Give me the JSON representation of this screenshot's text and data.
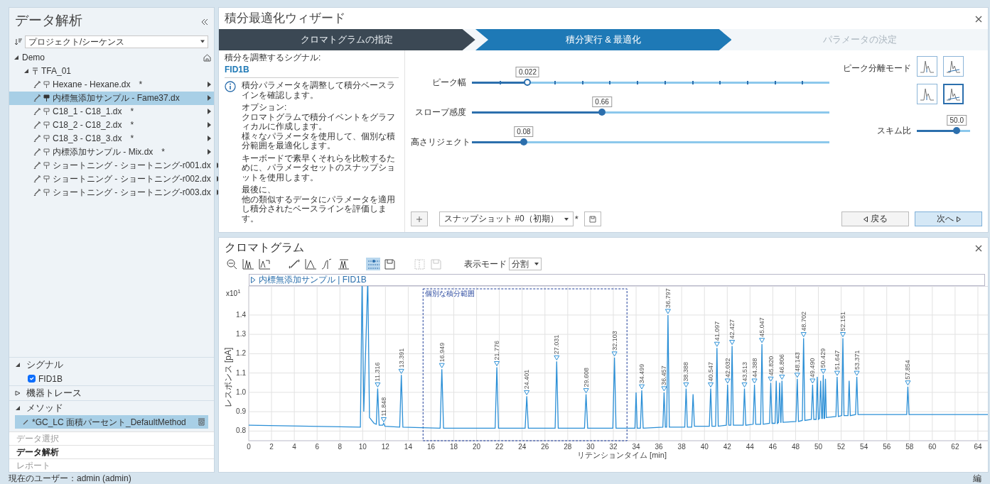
{
  "left_panel": {
    "title": "データ解析",
    "selector": {
      "value": "プロジェクト/シーケンス"
    },
    "tree": [
      {
        "label": "Demo",
        "expanded": true,
        "children": [
          {
            "label": "TFA_01",
            "expanded": true,
            "children": [
              {
                "label": "Hexane - Hexane.dx",
                "flag": "*",
                "selected": false
              },
              {
                "label": "内標無添加サンプル - Fame37.dx",
                "selected": true
              },
              {
                "label": "C18_1 - C18_1.dx",
                "flag": "*",
                "selected": false
              },
              {
                "label": "C18_2 - C18_2.dx",
                "flag": "*",
                "selected": false
              },
              {
                "label": "C18_3 - C18_3.dx",
                "flag": "*",
                "selected": false
              },
              {
                "label": "内標添加サンプル - Mix.dx",
                "flag": "*",
                "selected": false
              },
              {
                "label": "ショートニング - ショートニング-r001.dx",
                "selected": false
              },
              {
                "label": "ショートニング - ショートニング-r002.dx",
                "selected": false
              },
              {
                "label": "ショートニング - ショートニング-r003.dx",
                "selected": false
              }
            ]
          }
        ]
      }
    ],
    "sections": [
      {
        "label": "シグナル",
        "expanded": true,
        "items": [
          {
            "kind": "checkbox",
            "label": "FID1B",
            "checked": true
          }
        ]
      },
      {
        "label": "機器トレース",
        "expanded": false
      },
      {
        "label": "メソッド",
        "expanded": true,
        "items": [
          {
            "kind": "method",
            "label": "*GC_LC 面積パーセント_DefaultMethod",
            "selected": true
          }
        ]
      }
    ],
    "nav": [
      {
        "label": "データ選択",
        "selected": false
      },
      {
        "label": "データ解析",
        "selected": true
      },
      {
        "label": "レポート",
        "selected": false
      }
    ]
  },
  "wizard": {
    "title": "積分最適化ウィザード",
    "steps": [
      {
        "label": "クロマトグラムの指定",
        "done": true,
        "selected": false
      },
      {
        "label": "積分実行 & 最適化",
        "done": false,
        "selected": true
      },
      {
        "label": "パラメータの決定",
        "done": false,
        "selected": false
      }
    ],
    "signal_label": "積分を調整するシグナル:",
    "signal": "FID1B",
    "info": [
      [
        "積分パラメータを調整して積分ベースラインを確認します。"
      ],
      [
        "オプション:",
        "クロマトグラムで積分イベントをグラフィカルに作成します。",
        "様々なパラメータを使用して、個別な積分範囲を最適化します。"
      ],
      [
        "キーボードで素早くそれらを比較するために、パラメータセットのスナップショットを使用します。"
      ],
      [
        "最後に、",
        "他の類似するデータにパラメータを適用し積分されたベースラインを評価します。"
      ]
    ],
    "sliders": [
      {
        "label": "ピーク幅",
        "kind": "ticked",
        "level": 0.156,
        "reading": "0.022"
      },
      {
        "label": "スロープ感度",
        "kind": "plain",
        "level": 0.364,
        "reading": "0.66"
      },
      {
        "label": "高さリジェクト",
        "kind": "plain",
        "level": 0.145,
        "reading": "0.08"
      }
    ],
    "peak_mode": {
      "label": "ピーク分離モード",
      "options": [
        {
          "selected": false
        },
        {
          "selected": false
        },
        {
          "selected": false
        },
        {
          "selected": true
        }
      ]
    },
    "skim": {
      "label": "スキム比",
      "level": 0.75,
      "reading": "50.0"
    },
    "snapshot": {
      "value": "スナップショット #0（初期）",
      "flag": "*"
    },
    "buttons": [
      {
        "label": "戻る",
        "kind": "back"
      },
      {
        "label": "次へ",
        "kind": "next"
      }
    ]
  },
  "chromatogram": {
    "title": "クロマトグラム",
    "toolbar": [
      {
        "selected": false,
        "disabled": false
      },
      {
        "selected": false,
        "disabled": false
      },
      {
        "selected": false,
        "disabled": false
      },
      {
        "selected": false,
        "disabled": false
      },
      {
        "selected": false,
        "disabled": false
      },
      {
        "selected": false,
        "disabled": false
      },
      {
        "selected": false,
        "disabled": false
      },
      {
        "selected": true,
        "disabled": false
      },
      {
        "selected": false,
        "disabled": false
      },
      {
        "selected": false,
        "disabled": true
      },
      {
        "selected": false,
        "disabled": true
      }
    ],
    "display_mode": {
      "label": "表示モード",
      "value": "分割"
    },
    "scale_label": "x10$^{1}$",
    "chart_data": {
      "type": "line",
      "title": "内標無添加サンプル | FID1B",
      "xlabel": "リテンションタイム [min]",
      "ylabel": "レスポンス [pA]",
      "grid": true,
      "xlim": [
        0,
        65.5
      ],
      "ylim": [
        0.75,
        1.55
      ],
      "xticks": [
        0,
        2,
        4,
        6,
        8,
        10,
        12,
        14,
        16,
        18,
        20,
        22,
        24,
        26,
        28,
        30,
        32,
        34,
        36,
        38,
        40,
        42,
        44,
        46,
        48,
        50,
        52,
        54,
        56,
        58,
        60,
        62,
        64
      ],
      "yticks": [
        0.8,
        0.9,
        {
          "value": 1,
          "label": "1.0"
        },
        1.1,
        1.2,
        1.3,
        1.4
      ],
      "x": [
        0,
        9.8,
        9.95,
        10.1,
        10.45,
        10.6,
        11.0,
        11.2,
        11.316,
        11.45,
        11.75,
        11.848,
        11.95,
        13.25,
        13.391,
        13.53,
        16.8,
        16.949,
        17.1,
        21.63,
        21.776,
        21.92,
        24.26,
        24.401,
        24.54,
        26.89,
        27.031,
        27.17,
        29.47,
        29.608,
        29.75,
        31.96,
        32.103,
        32.24,
        33.9,
        34.0,
        34.1,
        34.38,
        34.499,
        34.62,
        36.35,
        36.457,
        36.57,
        36.68,
        36.797,
        36.92,
        38.27,
        38.388,
        38.5,
        38.88,
        39.0,
        39.12,
        40.43,
        40.547,
        40.66,
        40.98,
        41.097,
        41.21,
        41.92,
        42.032,
        42.14,
        42.31,
        42.427,
        42.54,
        43.4,
        43.513,
        43.63,
        44.27,
        44.388,
        44.5,
        44.93,
        45.047,
        45.16,
        45.71,
        45.82,
        45.93,
        46.2,
        46.3,
        46.4,
        46.5,
        46.6,
        46.7,
        46.72,
        46.806,
        46.9,
        48.03,
        48.143,
        48.25,
        48.59,
        48.702,
        48.81,
        49.38,
        49.49,
        49.6,
        49.8,
        49.9,
        50.0,
        50.1,
        50.2,
        50.3,
        50.35,
        50.429,
        50.5,
        50.55,
        50.62,
        50.7,
        51.54,
        51.647,
        51.75,
        52.05,
        52.151,
        52.25,
        52.6,
        52.7,
        52.8,
        53.26,
        53.371,
        53.48,
        57.75,
        57.854,
        57.96,
        65.5
      ],
      "series": [
        {
          "color": "#2b8fd6",
          "values": [
            0.83,
            0.82,
            null,
            0.9,
            null,
            0.87,
            0.84,
            0.835,
            1.02,
            0.83,
            0.83,
            0.84,
            0.825,
            0.82,
            1.09,
            0.82,
            0.815,
            1.12,
            0.815,
            0.815,
            1.13,
            0.815,
            0.815,
            0.98,
            0.815,
            0.815,
            1.16,
            0.815,
            0.815,
            0.99,
            0.815,
            0.815,
            1.18,
            0.815,
            0.815,
            1.0,
            0.815,
            0.815,
            1.01,
            0.815,
            0.82,
            1.0,
            0.82,
            0.82,
            1.4,
            0.82,
            0.82,
            1.02,
            0.82,
            0.82,
            0.99,
            0.825,
            0.825,
            1.02,
            0.825,
            0.825,
            1.23,
            0.825,
            0.83,
            1.04,
            0.83,
            0.83,
            1.24,
            0.83,
            0.83,
            1.02,
            0.83,
            0.835,
            1.04,
            0.835,
            0.835,
            1.25,
            0.835,
            0.84,
            1.05,
            0.84,
            0.84,
            1.06,
            0.84,
            0.845,
            1.05,
            0.845,
            0.845,
            1.06,
            0.845,
            0.85,
            1.07,
            0.85,
            0.855,
            1.28,
            0.855,
            0.86,
            1.04,
            0.86,
            0.86,
            1.08,
            0.86,
            0.865,
            1.06,
            0.865,
            0.865,
            1.09,
            0.865,
            0.865,
            1.07,
            0.87,
            0.875,
            1.08,
            0.875,
            0.88,
            1.28,
            0.88,
            0.88,
            1.06,
            0.88,
            0.885,
            1.08,
            0.885,
            0.885,
            1.03,
            0.885,
            0.885
          ]
        }
      ],
      "annotations": [
        "個別な積分範囲",
        {
          "x": 11.316,
          "y": 1.02,
          "text": "11.316"
        },
        {
          "x": 11.848,
          "y": 0.84,
          "text": "11.848"
        },
        {
          "x": 13.391,
          "y": 1.09,
          "text": "13.391"
        },
        {
          "x": 16.949,
          "y": 1.12,
          "text": "16.949"
        },
        {
          "x": 21.776,
          "y": 1.13,
          "text": "21.776"
        },
        {
          "x": 24.401,
          "y": 0.98,
          "text": "24.401"
        },
        {
          "x": 27.031,
          "y": 1.16,
          "text": "27.031"
        },
        {
          "x": 29.608,
          "y": 0.99,
          "text": "29.608"
        },
        {
          "x": 32.103,
          "y": 1.18,
          "text": "32.103"
        },
        {
          "x": 34.499,
          "y": 1.01,
          "text": "34.499"
        },
        {
          "x": 36.457,
          "y": 1.0,
          "text": "36.457"
        },
        {
          "x": 36.797,
          "y": 1.4,
          "text": "36.797"
        },
        {
          "x": 38.388,
          "y": 1.02,
          "text": "38.388"
        },
        {
          "x": 40.547,
          "y": 1.02,
          "text": "40.547"
        },
        {
          "x": 41.097,
          "y": 1.23,
          "text": "41.097"
        },
        {
          "x": 42.032,
          "y": 1.04,
          "text": "42.032"
        },
        {
          "x": 42.427,
          "y": 1.24,
          "text": "42.427"
        },
        {
          "x": 43.513,
          "y": 1.02,
          "text": "43.513"
        },
        {
          "x": 44.388,
          "y": 1.04,
          "text": "44.388"
        },
        {
          "x": 45.047,
          "y": 1.25,
          "text": "45.047"
        },
        {
          "x": 45.82,
          "y": 1.05,
          "text": "45.820"
        },
        {
          "x": 46.806,
          "y": 1.06,
          "text": "46.806"
        },
        {
          "x": 48.143,
          "y": 1.07,
          "text": "48.143"
        },
        {
          "x": 48.702,
          "y": 1.28,
          "text": "48.702"
        },
        {
          "x": 49.49,
          "y": 1.04,
          "text": "49.490"
        },
        {
          "x": 50.429,
          "y": 1.09,
          "text": "50.429"
        },
        {
          "x": 51.647,
          "y": 1.08,
          "text": "51.647"
        },
        {
          "x": 52.151,
          "y": 1.28,
          "text": "52.151"
        },
        {
          "x": 53.371,
          "y": 1.08,
          "text": "53.371"
        },
        {
          "x": 57.854,
          "y": 1.03,
          "text": "57.854"
        }
      ]
    }
  },
  "status_bar": {
    "user": "現在のユーザー：admin (admin)",
    "right": "編"
  }
}
